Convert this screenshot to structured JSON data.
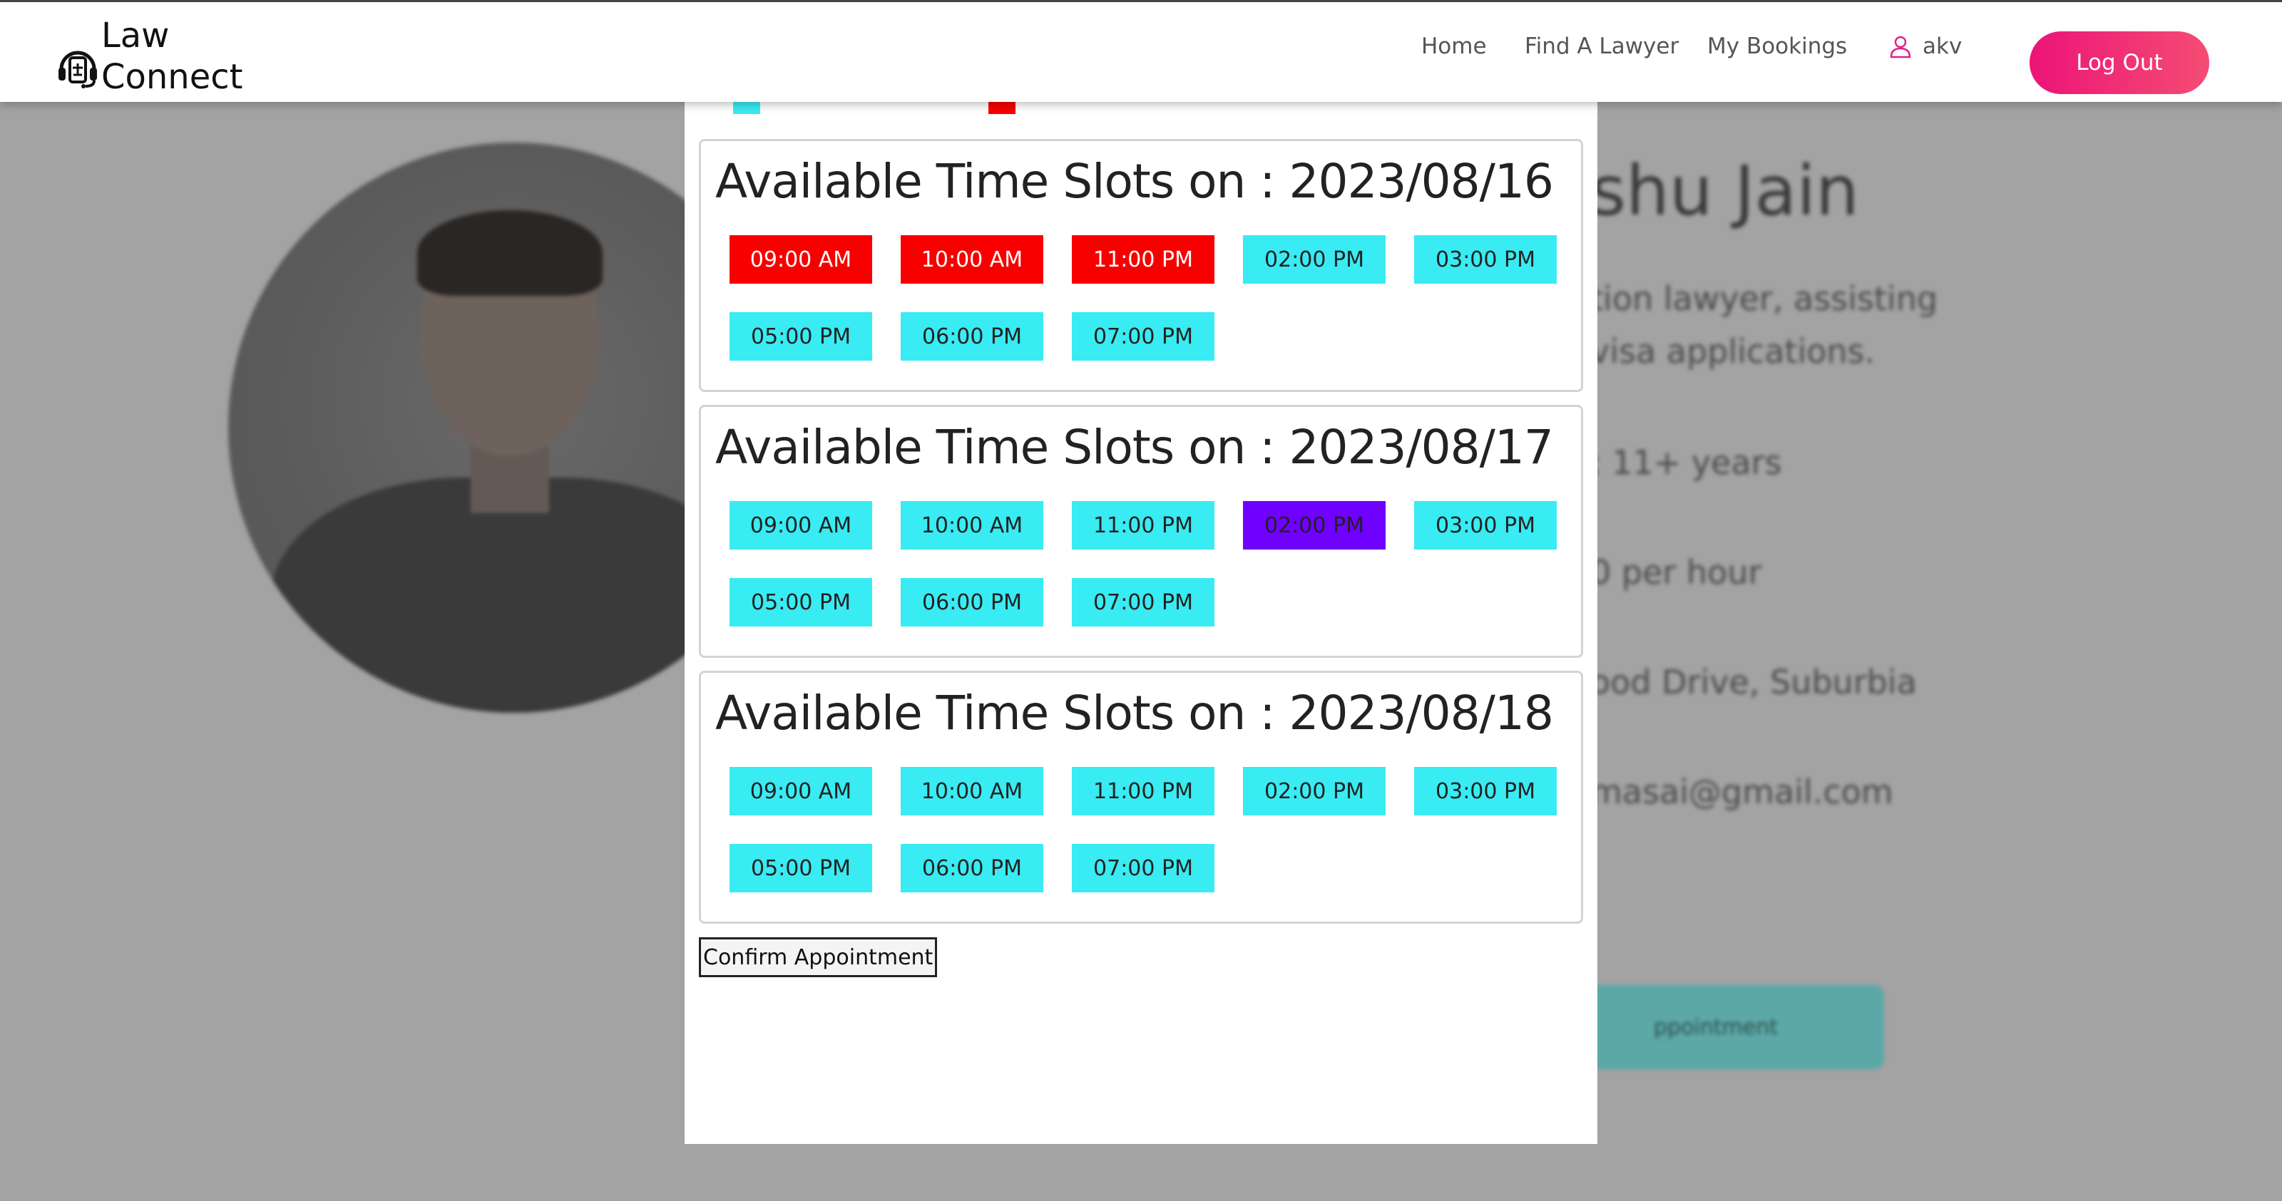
{
  "brand": {
    "line1": "Law",
    "line2": "Connect"
  },
  "nav": {
    "links": [
      "Home",
      "Find A Lawyer",
      "My Bookings"
    ],
    "user": "akv",
    "logout_label": "Log Out"
  },
  "background_profile": {
    "title_fragment": "shu Jain",
    "desc_line1": "tion lawyer, assisting",
    "desc_line2": "visa applications.",
    "experience_fragment": ": 11+ years",
    "fee_fragment": "0 per hour",
    "address_fragment": "ood Drive, Suburbia",
    "email_fragment": "masai@gmail.com",
    "button_fragment": "ppointment"
  },
  "colors": {
    "available": "#39ebf2",
    "booked": "#f90000",
    "selected": "#7000ff",
    "logout_gradient_start": "#ec1378",
    "logout_gradient_end": "#f44d73"
  },
  "slot_days": [
    {
      "heading": "Available Time Slots on : 2023/08/16",
      "slots": [
        {
          "time": "09:00 AM",
          "status": "booked"
        },
        {
          "time": "10:00 AM",
          "status": "booked"
        },
        {
          "time": "11:00 PM",
          "status": "booked"
        },
        {
          "time": "02:00 PM",
          "status": "available"
        },
        {
          "time": "03:00 PM",
          "status": "available"
        },
        {
          "time": "05:00 PM",
          "status": "available"
        },
        {
          "time": "06:00 PM",
          "status": "available"
        },
        {
          "time": "07:00 PM",
          "status": "available"
        }
      ]
    },
    {
      "heading": "Available Time Slots on : 2023/08/17",
      "slots": [
        {
          "time": "09:00 AM",
          "status": "available"
        },
        {
          "time": "10:00 AM",
          "status": "available"
        },
        {
          "time": "11:00 PM",
          "status": "available"
        },
        {
          "time": "02:00 PM",
          "status": "selected"
        },
        {
          "time": "03:00 PM",
          "status": "available"
        },
        {
          "time": "05:00 PM",
          "status": "available"
        },
        {
          "time": "06:00 PM",
          "status": "available"
        },
        {
          "time": "07:00 PM",
          "status": "available"
        }
      ]
    },
    {
      "heading": "Available Time Slots on : 2023/08/18",
      "slots": [
        {
          "time": "09:00 AM",
          "status": "available"
        },
        {
          "time": "10:00 AM",
          "status": "available"
        },
        {
          "time": "11:00 PM",
          "status": "available"
        },
        {
          "time": "02:00 PM",
          "status": "available"
        },
        {
          "time": "03:00 PM",
          "status": "available"
        },
        {
          "time": "05:00 PM",
          "status": "available"
        },
        {
          "time": "06:00 PM",
          "status": "available"
        },
        {
          "time": "07:00 PM",
          "status": "available"
        }
      ]
    }
  ],
  "confirm_label": "Confirm Appointment"
}
